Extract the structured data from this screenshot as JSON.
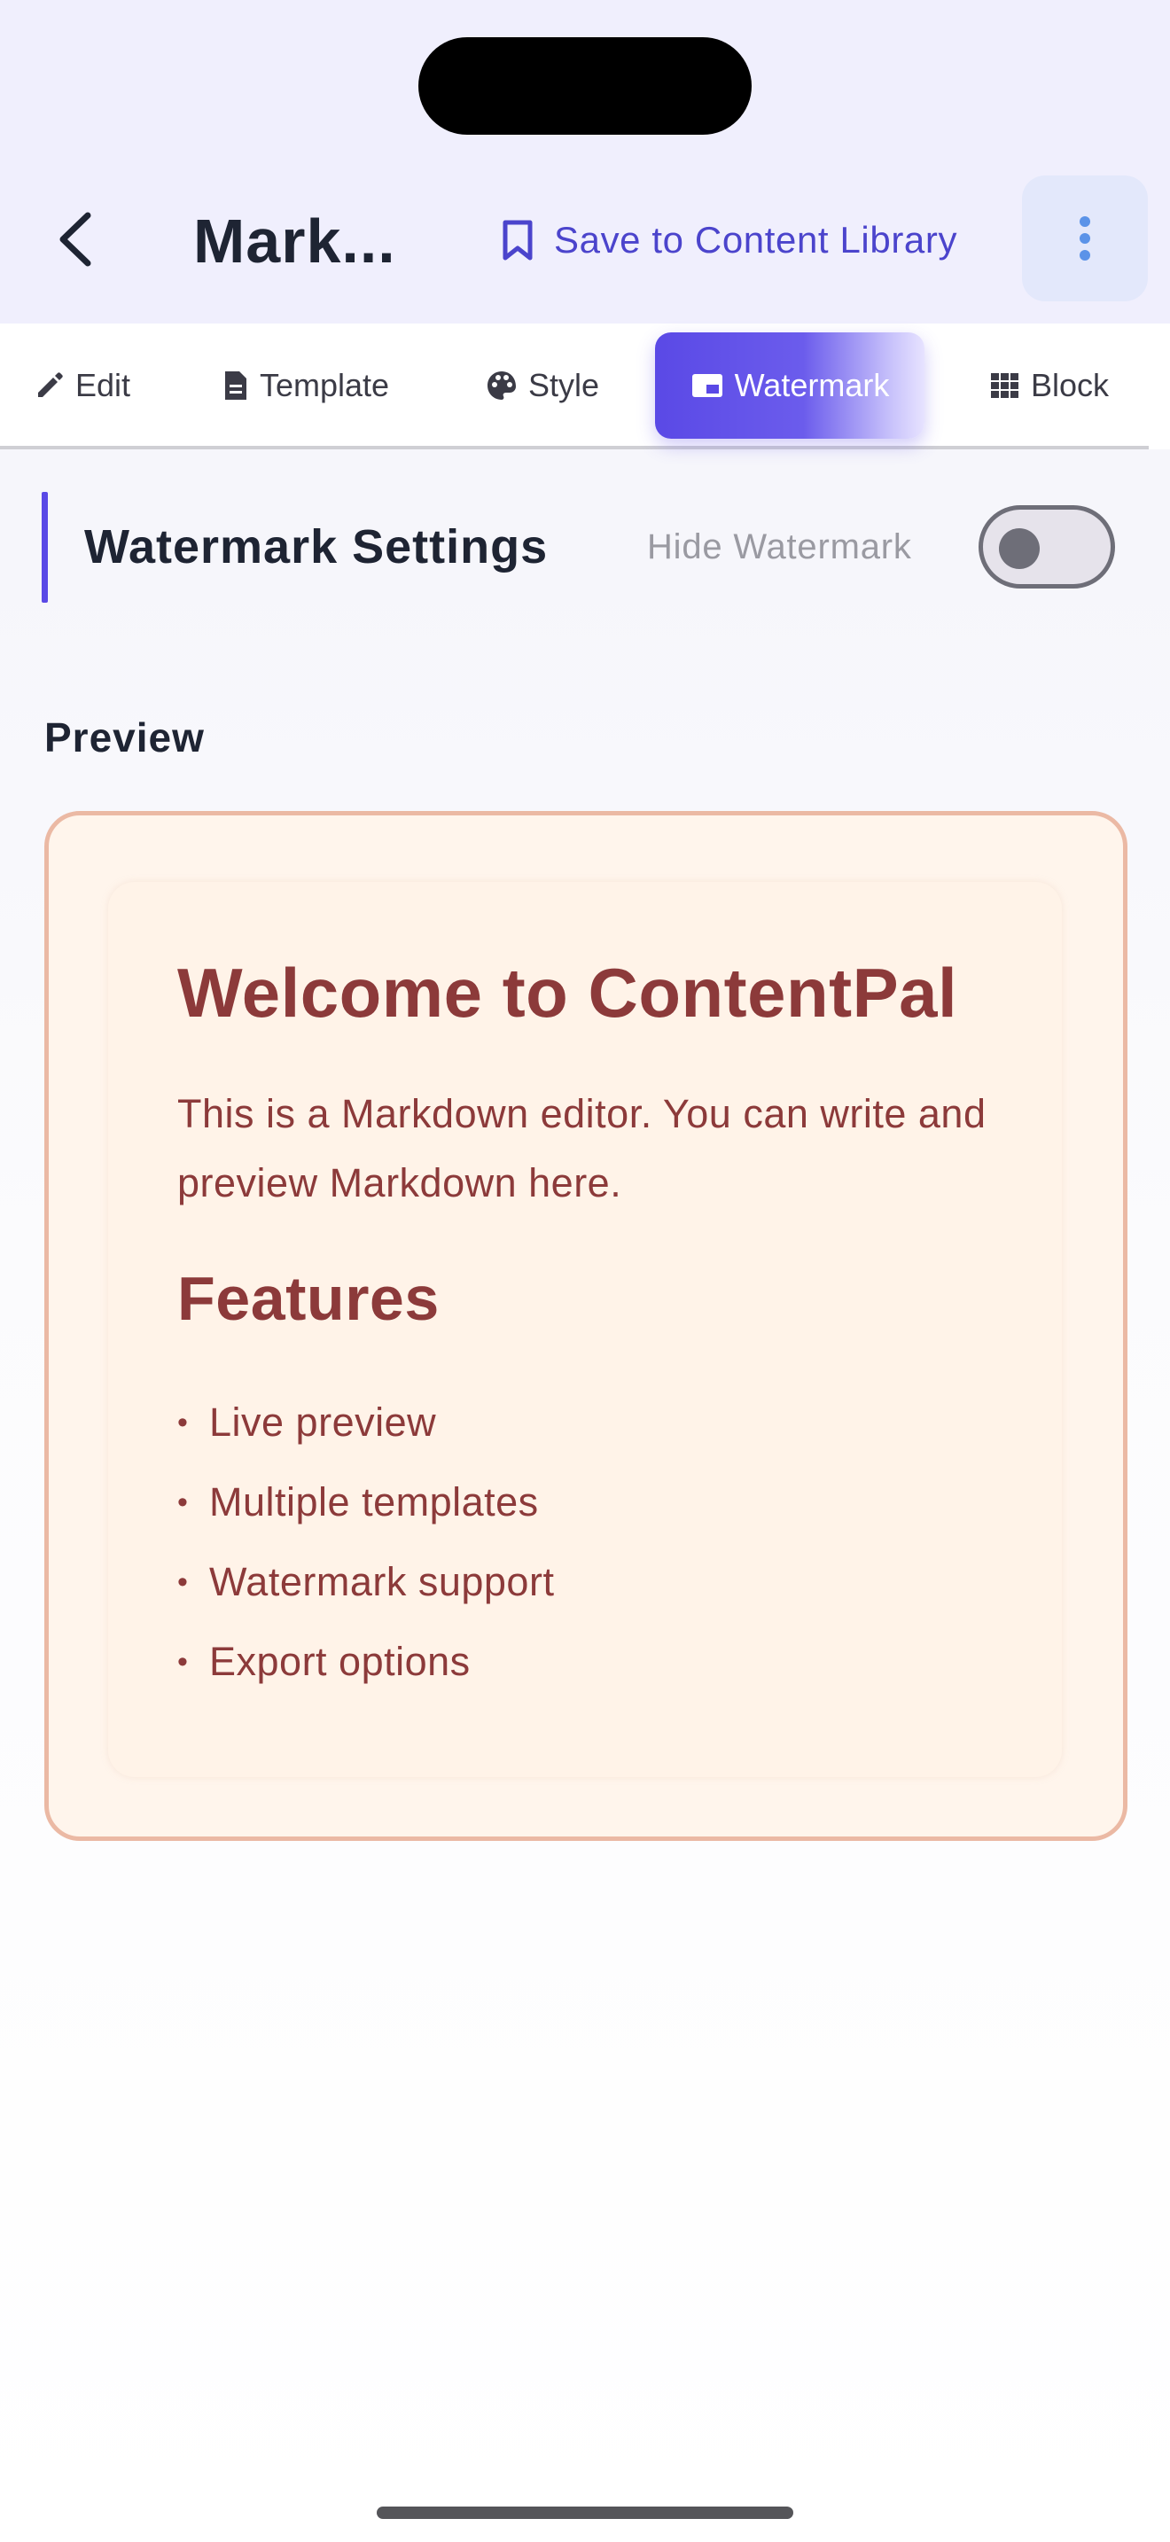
{
  "header": {
    "title": "Mark...",
    "save_label": "Save to Content Library"
  },
  "tabs": [
    {
      "label": "Edit",
      "icon": "pencil-icon"
    },
    {
      "label": "Template",
      "icon": "document-icon"
    },
    {
      "label": "Style",
      "icon": "palette-icon"
    },
    {
      "label": "Watermark",
      "icon": "watermark-icon",
      "active": true
    },
    {
      "label": "Block",
      "icon": "grid-icon"
    }
  ],
  "settings": {
    "title": "Watermark Settings",
    "hide_label": "Hide Watermark",
    "hide_watermark_on": false
  },
  "preview": {
    "label": "Preview",
    "heading": "Welcome to ContentPal",
    "paragraph": "This is a Markdown editor. You can write and preview Markdown here.",
    "subheading": "Features",
    "bullet": "•",
    "items": [
      "Live preview",
      "Multiple templates",
      "Watermark support",
      "Export options"
    ]
  },
  "colors": {
    "accent": "#5a49e6",
    "link": "#4b44cc",
    "preview_text": "#8c3a3a",
    "preview_border": "#ebb9a4",
    "preview_bg": "#fff5ec"
  }
}
